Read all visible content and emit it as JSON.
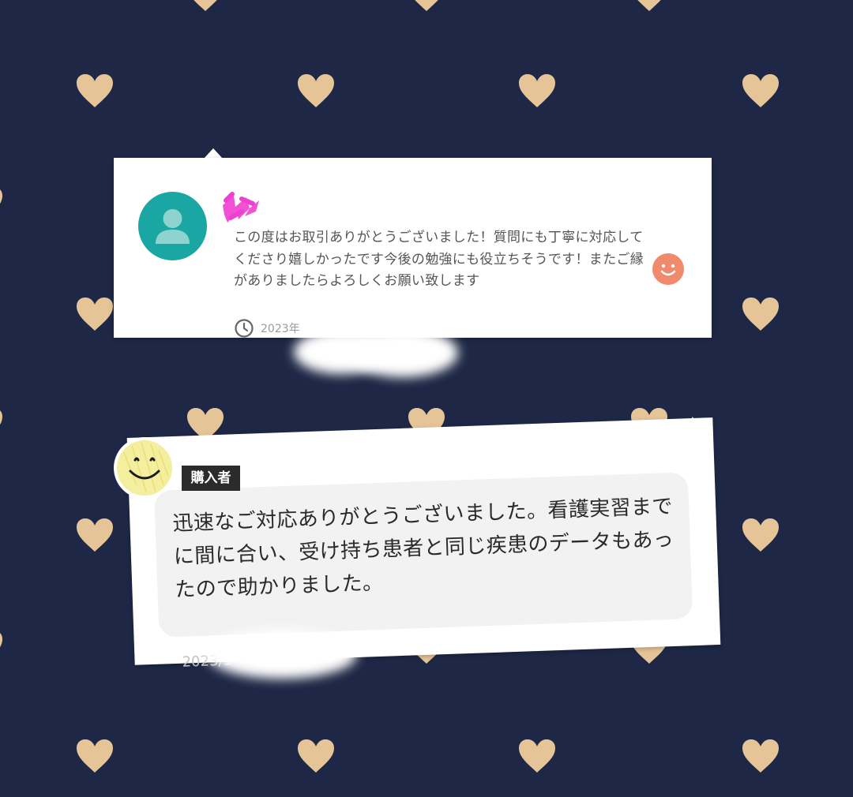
{
  "background": {
    "color": "#1e2846",
    "heart_color": "#e5c597",
    "pattern_icon": "heart-icon"
  },
  "review_card_1": {
    "avatar_icon": "user-avatar-icon",
    "avatar_color": "#1aa7a3",
    "text": "この度はお取引ありがとうございました！質問にも丁寧に対応してくださり嬉しかったです今後の勉強にも役立ちそうです！またご縁がありましたらよろしくお願い致します",
    "rating_icon": "smile-face-icon",
    "rating_color": "#f08a6c",
    "date_icon": "clock-icon",
    "date_text": "2023年"
  },
  "review_card_2": {
    "badge_label": "購入者",
    "icon": "yellow-smiley-icon",
    "text": "迅速なご対応ありがとうございました。看護実習までに間に合い、受け持ち患者と同じ疾患のデータもあったので助かりました。",
    "date_text": "2023/1"
  }
}
